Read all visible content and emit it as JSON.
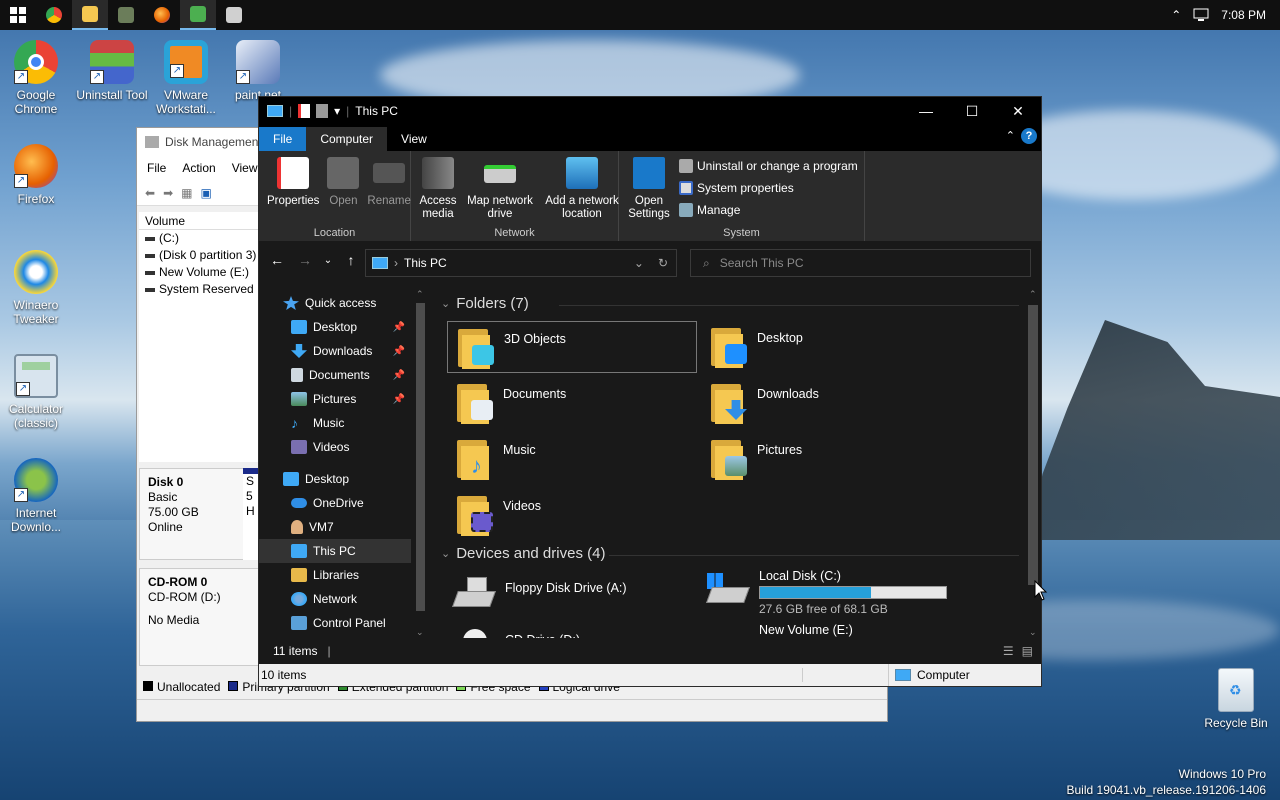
{
  "taskbar": {
    "apps": [
      "start",
      "chrome",
      "file-explorer",
      "uninstall-tool",
      "firefox",
      "winaero-tweaker",
      "disk-management"
    ],
    "time": "7:08 PM"
  },
  "desktop": {
    "icons": [
      {
        "label": "Google Chrome",
        "icon": "chrome-icon"
      },
      {
        "label": "Uninstall Tool",
        "icon": "uninstall-tool-icon"
      },
      {
        "label": "VMware Workstati...",
        "icon": "vmware-icon"
      },
      {
        "label": "paint.net",
        "icon": "paintnet-icon"
      },
      {
        "label": "Firefox",
        "icon": "firefox-icon"
      },
      {
        "label": "Winaero Tweaker",
        "icon": "winaero-icon"
      },
      {
        "label": "Calculator (classic)",
        "icon": "calculator-icon"
      },
      {
        "label": "Internet Downlo...",
        "icon": "idm-icon"
      },
      {
        "label": "Recycle Bin",
        "icon": "recycle-bin-icon"
      }
    ],
    "watermark": {
      "line1": "Windows 10 Pro",
      "line2": "Build 19041.vb_release.191206-1406"
    }
  },
  "disk_management": {
    "title": "Disk Managemen",
    "menu": [
      "File",
      "Action",
      "View"
    ],
    "volume_header": "Volume",
    "volumes": [
      "(C:)",
      "(Disk 0 partition 3)",
      "New Volume (E:)",
      "System Reserved"
    ],
    "disk0": {
      "name": "Disk 0",
      "type": "Basic",
      "size": "75.00 GB",
      "status": "Online"
    },
    "cdrom0": {
      "name": "CD-ROM 0",
      "drive": "CD-ROM (D:)",
      "media": "No Media"
    },
    "legend": [
      "Unallocated",
      "Primary partition",
      "Extended partition",
      "Free space",
      "Logical drive"
    ],
    "partition_stub": {
      "line1": "S",
      "line2": "5",
      "line3": "H"
    }
  },
  "explorer": {
    "title": "This PC",
    "tabs": {
      "file": "File",
      "computer": "Computer",
      "view": "View"
    },
    "ribbon": {
      "location": {
        "label": "Location",
        "properties": "Properties",
        "open": "Open",
        "rename": "Rename"
      },
      "network": {
        "label": "Network",
        "access_media": "Access media",
        "map_drive": "Map network drive",
        "add_location": "Add a network location"
      },
      "system": {
        "label": "System",
        "open_settings": "Open Settings",
        "uninstall": "Uninstall or change a program",
        "system_properties": "System properties",
        "manage": "Manage"
      }
    },
    "address": "This PC",
    "search_placeholder": "Search This PC",
    "nav": [
      {
        "label": "Quick access",
        "icon": "star-icon",
        "color": "#4aa3f0",
        "pinned": false
      },
      {
        "label": "Desktop",
        "icon": "desktop-icon",
        "color": "#3fa9f5",
        "pinned": true
      },
      {
        "label": "Downloads",
        "icon": "download-icon",
        "color": "#3fa9f5",
        "pinned": true
      },
      {
        "label": "Documents",
        "icon": "documents-icon",
        "color": "#cfd8e0",
        "pinned": true
      },
      {
        "label": "Pictures",
        "icon": "pictures-icon",
        "color": "#8ec3e8",
        "pinned": true
      },
      {
        "label": "Music",
        "icon": "music-icon",
        "color": "#3fa9f5",
        "pinned": false
      },
      {
        "label": "Videos",
        "icon": "videos-icon",
        "color": "#7a6fb0",
        "pinned": false
      },
      {
        "label": "Desktop",
        "icon": "desktop-icon",
        "color": "#3fa9f5",
        "pinned": false
      },
      {
        "label": "OneDrive",
        "icon": "onedrive-icon",
        "color": "#2f8ee6",
        "pinned": false
      },
      {
        "label": "VM7",
        "icon": "user-icon",
        "color": "#e0b080",
        "pinned": false
      },
      {
        "label": "This PC",
        "icon": "this-pc-icon",
        "color": "#3fa9f5",
        "pinned": false
      },
      {
        "label": "Libraries",
        "icon": "libraries-icon",
        "color": "#e8b94a",
        "pinned": false
      },
      {
        "label": "Network",
        "icon": "network-icon",
        "color": "#3fa9f5",
        "pinned": false
      },
      {
        "label": "Control Panel",
        "icon": "control-panel-icon",
        "color": "#5aa0d8",
        "pinned": false
      }
    ],
    "folders_header": "Folders (7)",
    "folders": [
      {
        "label": "3D Objects",
        "badge": "#3cc6e6"
      },
      {
        "label": "Desktop",
        "badge": "#1e90ff"
      },
      {
        "label": "Documents",
        "badge": "#e8eef4"
      },
      {
        "label": "Downloads",
        "badge": "#2f8ee6"
      },
      {
        "label": "Music",
        "badge": "#2f8ee6"
      },
      {
        "label": "Pictures",
        "badge": "#9cc7e6"
      },
      {
        "label": "Videos",
        "badge": "#6a5acd"
      }
    ],
    "devices_header": "Devices and drives (4)",
    "drives": [
      {
        "label": "Floppy Disk Drive (A:)"
      },
      {
        "label": "Local Disk (C:)",
        "free": "27.6 GB free of 68.1 GB",
        "used_fraction": 0.595
      },
      {
        "label": "CD Drive (D:)"
      },
      {
        "label": "New Volume (E:)"
      }
    ],
    "status_items": "11 items",
    "bottom_items": "10 items",
    "bottom_location": "Computer"
  }
}
